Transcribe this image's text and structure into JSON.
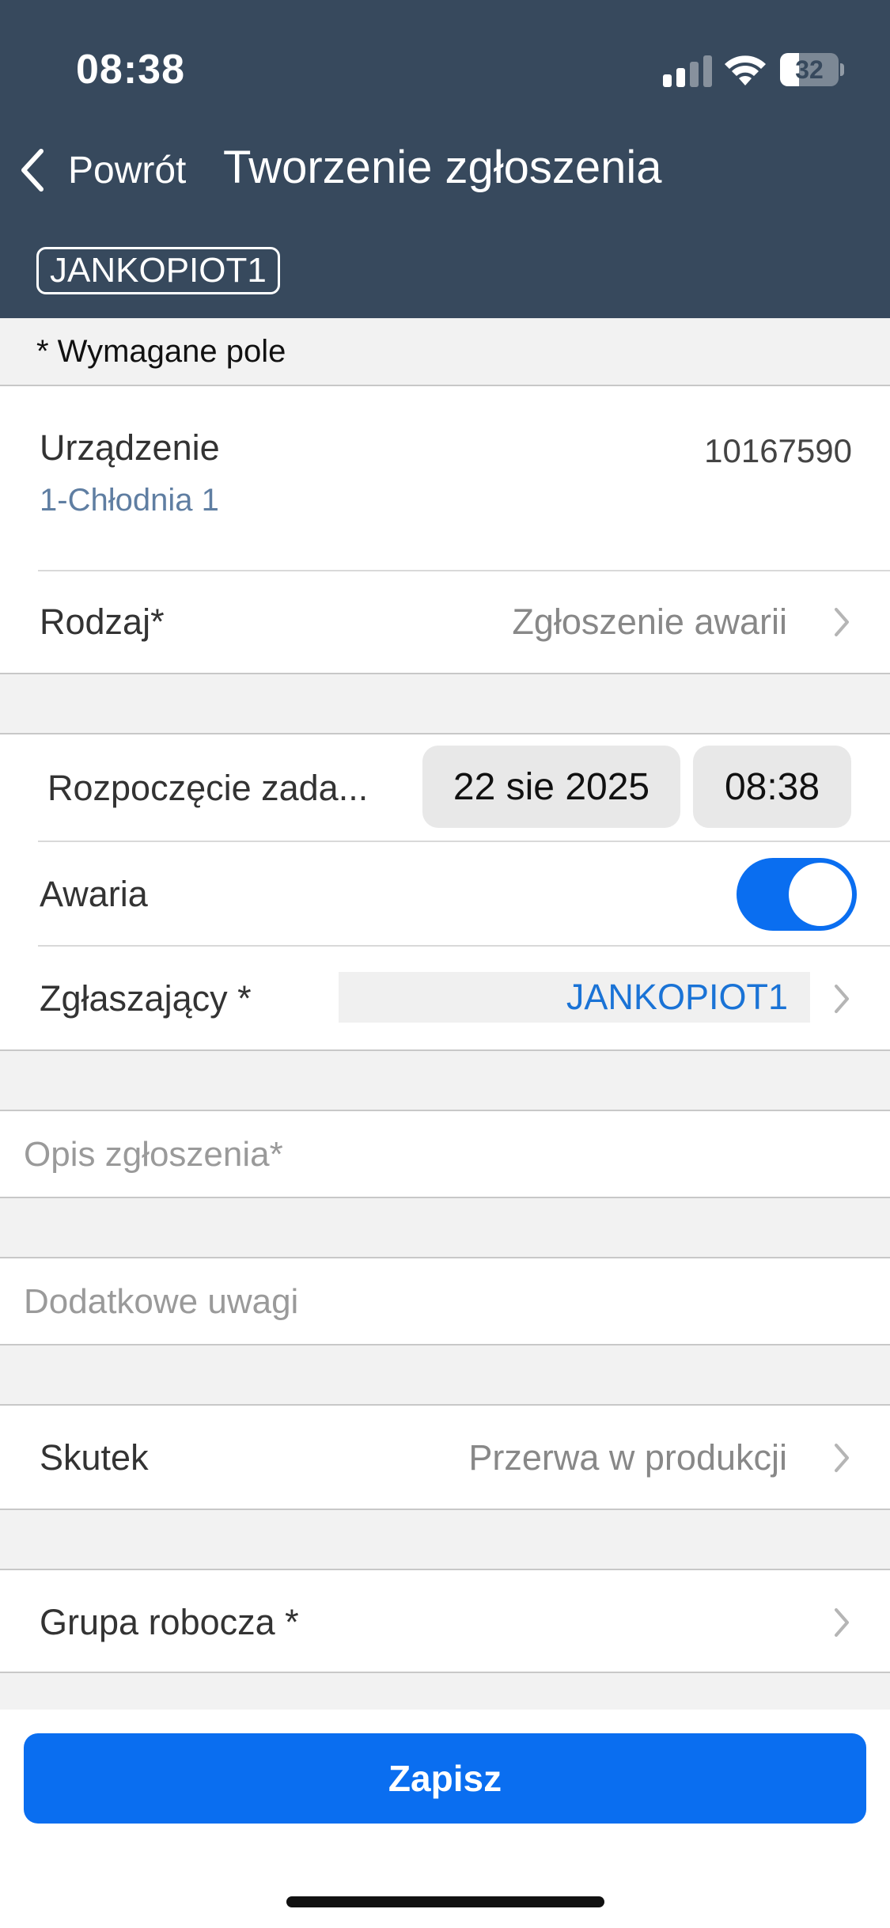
{
  "status_bar": {
    "time": "08:38",
    "battery_percent": "32",
    "battery_level": 0.32,
    "icons": [
      "signal-icon",
      "wifi-icon",
      "battery-icon"
    ]
  },
  "nav": {
    "back_label": "Powrót",
    "title": "Tworzenie zgłoszenia",
    "user_chip": "JANKOPIOT1"
  },
  "form": {
    "required_note": "* Wymagane pole",
    "device": {
      "label": "Urządzenie",
      "number": "10167590",
      "name": "1-Chłodnia 1"
    },
    "type": {
      "label": "Rodzaj*",
      "value": "Zgłoszenie awarii"
    },
    "start": {
      "label": "Rozpoczęcie zada...",
      "date": "22 sie 2025",
      "time": "08:38"
    },
    "failure": {
      "label": "Awaria",
      "enabled": true
    },
    "reporter": {
      "label": "Zgłaszający *",
      "value": "JANKOPIOT1"
    },
    "description": {
      "placeholder": "Opis zgłoszenia*"
    },
    "notes": {
      "placeholder": "Dodatkowe uwagi"
    },
    "effect": {
      "label": "Skutek",
      "value": "Przerwa w produkcji"
    },
    "workgroup": {
      "label": "Grupa robocza *"
    }
  },
  "actions": {
    "save_label": "Zapisz"
  },
  "colors": {
    "header_bg": "#37495d",
    "accent": "#0a6ef0",
    "link": "#1a73d6"
  }
}
